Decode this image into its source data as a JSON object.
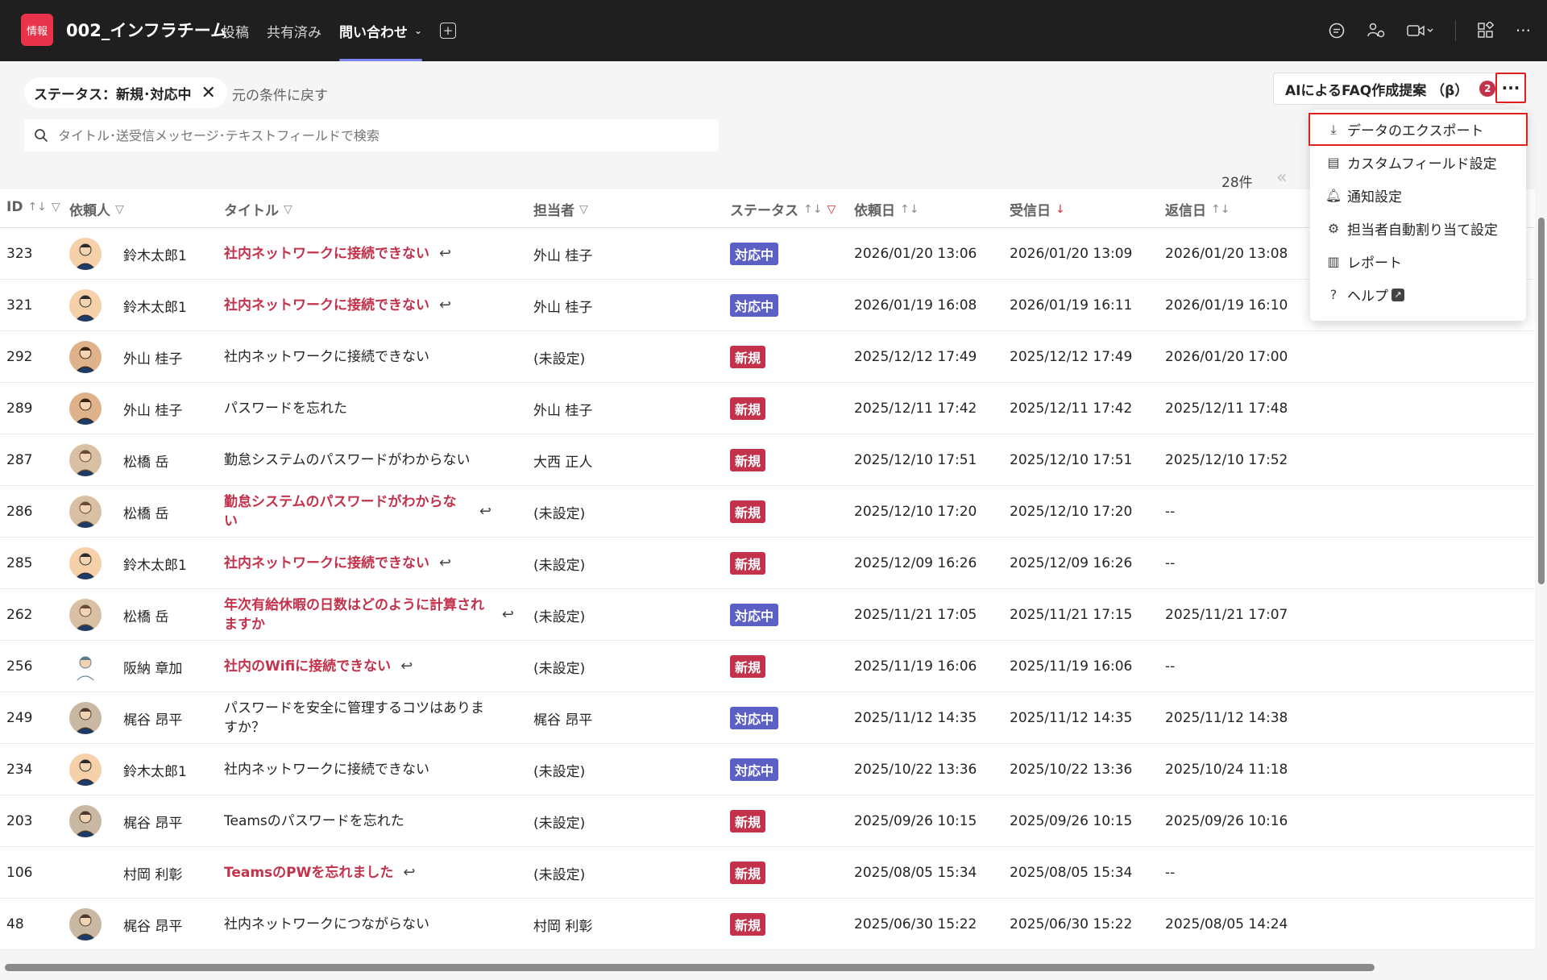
{
  "app": {
    "badge": "情報",
    "title": "002_インフラチーム",
    "tabs": [
      {
        "label": "投稿"
      },
      {
        "label": "共有済み"
      },
      {
        "label": "問い合わせ"
      }
    ]
  },
  "filter": {
    "chip_label": "ステータス：新規･対応中",
    "reset_label": "元の条件に戻す",
    "search_placeholder": "タイトル･送受信メッセージ･テキストフィールドで検索"
  },
  "ai_button": {
    "label": "AIによるFAQ作成提案 （β）",
    "badge": "2"
  },
  "more_button": {
    "label": "···"
  },
  "result_count": "28件",
  "columns": {
    "id": "ID",
    "requester": "依頼人",
    "title": "タイトル",
    "assignee": "担当者",
    "status": "ステータス",
    "request_date": "依頼日",
    "received_date": "受信日",
    "reply_date": "返信日"
  },
  "rows": [
    {
      "id": "323",
      "requester": "鈴木太郎1",
      "title": "社内ネットワークに接続できない",
      "assignee": "外山 桂子",
      "status": "対応中",
      "request_date": "2026/01/20 13:06",
      "received_date": "2026/01/20 13:09",
      "reply_date": "2026/01/20 13:08"
    },
    {
      "id": "321",
      "requester": "鈴木太郎1",
      "title": "社内ネットワークに接続できない",
      "assignee": "外山 桂子",
      "status": "対応中",
      "request_date": "2026/01/19 16:08",
      "received_date": "2026/01/19 16:11",
      "reply_date": "2026/01/19 16:10"
    },
    {
      "id": "292",
      "requester": "外山 桂子",
      "title": "社内ネットワークに接続できない",
      "assignee": "(未設定)",
      "status": "新規",
      "request_date": "2025/12/12 17:49",
      "received_date": "2025/12/12 17:49",
      "reply_date": "2026/01/20 17:00"
    },
    {
      "id": "289",
      "requester": "外山 桂子",
      "title": "パスワードを忘れた",
      "assignee": "外山 桂子",
      "status": "新規",
      "request_date": "2025/12/11 17:42",
      "received_date": "2025/12/11 17:42",
      "reply_date": "2025/12/11 17:48"
    },
    {
      "id": "287",
      "requester": "松橋 岳",
      "title": "勤怠システムのパスワードがわからない",
      "assignee": "大西 正人",
      "status": "新規",
      "request_date": "2025/12/10 17:51",
      "received_date": "2025/12/10 17:51",
      "reply_date": "2025/12/10 17:52"
    },
    {
      "id": "286",
      "requester": "松橋 岳",
      "title": "勤怠システムのパスワードがわからない",
      "assignee": "(未設定)",
      "status": "新規",
      "request_date": "2025/12/10 17:20",
      "received_date": "2025/12/10 17:20",
      "reply_date": "--"
    },
    {
      "id": "285",
      "requester": "鈴木太郎1",
      "title": "社内ネットワークに接続できない",
      "assignee": "(未設定)",
      "status": "新規",
      "request_date": "2025/12/09 16:26",
      "received_date": "2025/12/09 16:26",
      "reply_date": "--"
    },
    {
      "id": "262",
      "requester": "松橋 岳",
      "title": "年次有給休暇の日数はどのように計算されますか",
      "assignee": "(未設定)",
      "status": "対応中",
      "request_date": "2025/11/21 17:05",
      "received_date": "2025/11/21 17:15",
      "reply_date": "2025/11/21 17:07"
    },
    {
      "id": "256",
      "requester": "阪納 章加",
      "title": "社内のWifiに接続できない",
      "assignee": "(未設定)",
      "status": "新規",
      "request_date": "2025/11/19 16:06",
      "received_date": "2025/11/19 16:06",
      "reply_date": "--"
    },
    {
      "id": "249",
      "requester": "梶谷 昂平",
      "title": "パスワードを安全に管理するコツはありますか？",
      "assignee": "梶谷 昂平",
      "status": "対応中",
      "request_date": "2025/11/12 14:35",
      "received_date": "2025/11/12 14:35",
      "reply_date": "2025/11/12 14:38"
    },
    {
      "id": "234",
      "requester": "鈴木太郎1",
      "title": "社内ネットワークに接続できない",
      "assignee": "(未設定)",
      "status": "対応中",
      "request_date": "2025/10/22 13:36",
      "received_date": "2025/10/22 13:36",
      "reply_date": "2025/10/24 11:18"
    },
    {
      "id": "203",
      "requester": "梶谷 昂平",
      "title": "Teamsのパスワードを忘れた",
      "assignee": "(未設定)",
      "status": "新規",
      "request_date": "2025/09/26 10:15",
      "received_date": "2025/09/26 10:15",
      "reply_date": "2025/09/26 10:16"
    },
    {
      "id": "106",
      "requester": "村岡 利彰",
      "title": "TeamsのPWを忘れました",
      "assignee": "(未設定)",
      "status": "新規",
      "request_date": "2025/08/05 15:34",
      "received_date": "2025/08/05 15:34",
      "reply_date": "--"
    },
    {
      "id": "48",
      "requester": "梶谷 昂平",
      "title": "社内ネットワークにつながらない",
      "assignee": "村岡 利彰",
      "status": "新規",
      "request_date": "2025/06/30 15:22",
      "received_date": "2025/06/30 15:22",
      "reply_date": "2025/08/05 14:24"
    }
  ],
  "menu": [
    {
      "label": "データのエクスポート"
    },
    {
      "label": "カスタムフィールド設定"
    },
    {
      "label": "通知設定"
    },
    {
      "label": "担当者自動割り当て設定"
    },
    {
      "label": "レポート"
    },
    {
      "label": "ヘルプ"
    }
  ],
  "colors": {
    "accent": "#5b5fc7",
    "new": "#c4314b",
    "highlight": "#e02020"
  }
}
